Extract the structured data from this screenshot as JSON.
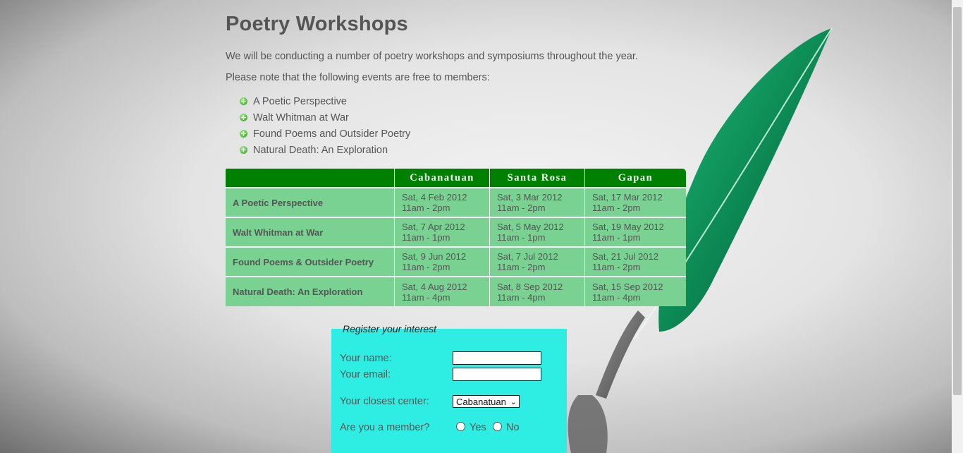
{
  "page": {
    "title": "Poetry Workshops",
    "intro": "We will be conducting a number of poetry workshops and symposiums throughout the year.",
    "note": "Please note that the following events are free to members:"
  },
  "events": [
    "A Poetic Perspective",
    "Walt Whitman at War",
    "Found Poems and Outsider Poetry",
    "Natural Death: An Exploration"
  ],
  "schedule": {
    "headers": [
      "",
      "Cabanatuan",
      "Santa Rosa",
      "Gapan"
    ],
    "rows": [
      {
        "name": "A Poetic Perspective",
        "cells": [
          {
            "date": "Sat, 4 Feb 2012",
            "time": "11am - 2pm"
          },
          {
            "date": "Sat, 3 Mar 2012",
            "time": "11am - 2pm"
          },
          {
            "date": "Sat, 17 Mar 2012",
            "time": "11am - 2pm"
          }
        ]
      },
      {
        "name": "Walt Whitman at War",
        "cells": [
          {
            "date": "Sat, 7 Apr 2012",
            "time": "11am - 1pm"
          },
          {
            "date": "Sat, 5 May 2012",
            "time": "11am - 1pm"
          },
          {
            "date": "Sat, 19 May 2012",
            "time": "11am - 1pm"
          }
        ]
      },
      {
        "name": "Found Poems & Outsider Poetry",
        "cells": [
          {
            "date": "Sat, 9 Jun 2012",
            "time": "11am - 2pm"
          },
          {
            "date": "Sat, 7 Jul 2012",
            "time": "11am - 2pm"
          },
          {
            "date": "Sat, 21 Jul 2012",
            "time": "11am - 2pm"
          }
        ]
      },
      {
        "name": "Natural Death: An Exploration",
        "cells": [
          {
            "date": "Sat, 4 Aug 2012",
            "time": "11am - 4pm"
          },
          {
            "date": "Sat, 8 Sep 2012",
            "time": "11am - 4pm"
          },
          {
            "date": "Sat, 15 Sep 2012",
            "time": "11am - 4pm"
          }
        ]
      }
    ]
  },
  "form": {
    "legend": "Register your interest",
    "name_label": "Your name:",
    "name_value": "",
    "email_label": "Your email:",
    "email_value": "",
    "center_label": "Your closest center:",
    "center_selected": "Cabanatuan",
    "member_label": "Are you a member?",
    "yes_label": "Yes",
    "no_label": "No"
  },
  "colors": {
    "header_green": "#008000",
    "cell_green": "#79d291",
    "form_cyan": "#2eeee3",
    "text": "#555555"
  },
  "icons": {
    "bullet": "plus-circle-icon",
    "background": "quill-feather-icon",
    "select_arrow": "chevron-down-icon"
  }
}
